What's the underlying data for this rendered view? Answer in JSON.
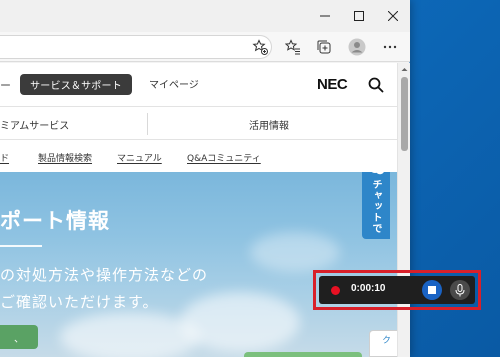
{
  "browser": {
    "window_controls": {
      "minimize": "—",
      "maximize": "□",
      "close": "✕"
    },
    "toolbar_icons": [
      "favorite-add-icon",
      "favorites-icon",
      "collections-icon",
      "profile-icon",
      "more-icon"
    ]
  },
  "site": {
    "header": {
      "nav_fragment": "ー",
      "support_button": "サービス＆サポート",
      "mypage_link": "マイページ",
      "logo": "NEC"
    },
    "category_nav": {
      "left": "ミアムサービス",
      "right": "活用情報"
    },
    "quick_links": [
      "ド",
      "製品情報検索",
      "マニュアル",
      "Q&Aコミュニティ"
    ],
    "hero": {
      "title": "ポート情報",
      "line1": "の対処方法や操作方法などの",
      "line2": "ご確認いただけます。",
      "button": "、"
    },
    "chat_tab": "チャットで",
    "corner_tab": "ク"
  },
  "recorder": {
    "time": "0:00:10",
    "status_color": "#e81123",
    "highlight_color": "#d8202a"
  }
}
